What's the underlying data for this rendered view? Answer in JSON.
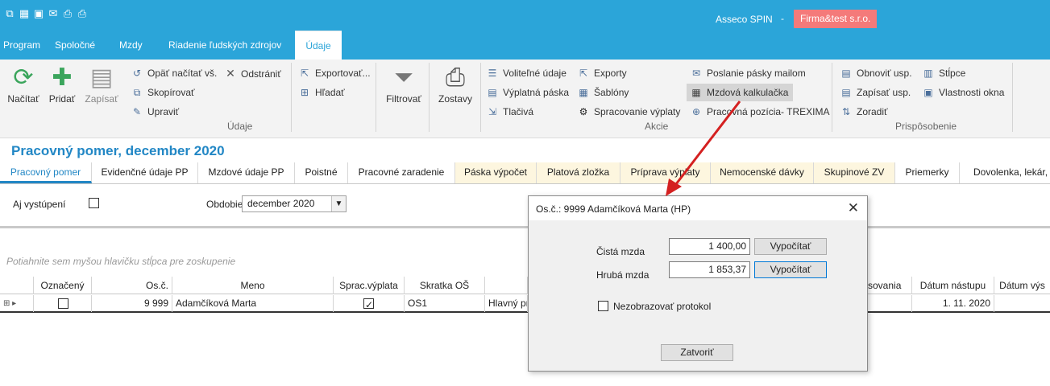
{
  "titlebar": {
    "app_name": "Asseco SPIN",
    "separator": "-",
    "firm": "Firma&test s.r.o."
  },
  "menu": {
    "items": [
      "Program",
      "Spoločné",
      "Mzdy",
      "Riadenie ľudských zdrojov",
      "Údaje"
    ],
    "active": "Údaje"
  },
  "ribbon": {
    "refresh": "Načítať",
    "add": "Pridať",
    "save": "Zapísať",
    "reload_all": "Opäť načítať vš.",
    "remove": "Odstrániť",
    "copy": "Skopírovať",
    "edit": "Upraviť",
    "group_data": "Údaje",
    "export": "Exportovať...",
    "find": "Hľadať",
    "filter": "Filtrovať",
    "reports": "Zostavy",
    "optional_data": "Voliteľné údaje",
    "payslip": "Výplatná páska",
    "forms": "Tlačivá",
    "exports": "Exporty",
    "templates": "Šablóny",
    "payroll_processing": "Spracovanie výplaty",
    "send_payslip": "Poslanie pásky mailom",
    "wage_calculator": "Mzdová kalkulačka",
    "job_position": "Pracovná pozícia- TREXIMA",
    "group_actions": "Akcie",
    "restore_settings": "Obnoviť usp.",
    "save_settings": "Zapísať usp.",
    "sort": "Zoradiť",
    "columns": "Stĺpce",
    "window_props": "Vlastnosti okna",
    "group_customize": "Prispôsobenie"
  },
  "page": {
    "title": "Pracovný pomer, december 2020"
  },
  "tabs": [
    "Pracovný pomer",
    "Evidenčné údaje PP",
    "Mzdové údaje PP",
    "Poistné",
    "Pracovné zaradenie",
    "Páska výpočet",
    "Platová zložka",
    "Príprava výplaty",
    "Nemocenské dávky",
    "Skupinové ZV",
    "Priemerky",
    "Dovolenka, lekár, z"
  ],
  "filters": {
    "include_departed_label": "Aj vystúpení",
    "period_label": "Obdobie",
    "period_value": "december 2020"
  },
  "grid": {
    "group_hint": "Potiahnite sem myšou hlavičku stĺpca pre zoskupenie",
    "columns": [
      "Označený",
      "Os.č.",
      "Meno",
      "Sprac.výplata",
      "Skratka OŠ",
      "sovania",
      "Dátum nástupu",
      "Dátum výs"
    ],
    "row": {
      "os_c": "9 999",
      "meno": "Adamčíková Marta",
      "skratka": "OS1",
      "desc": "Hlavný pr",
      "date_start": "1. 11. 2020"
    }
  },
  "dialog": {
    "title": "Os.č.: 9999 Adamčíková Marta (HP)",
    "net_label": "Čistá mzda",
    "net_value": "1 400,00",
    "gross_label": "Hrubá mzda",
    "gross_value": "1 853,37",
    "calc_button": "Vypočítať",
    "hide_protocol": "Nezobrazovať protokol",
    "close_button": "Zatvoriť"
  },
  "colors": {
    "accent": "#2ba5d9",
    "title_blue": "#2287c5",
    "firm_badge": "#f47a7a",
    "annotation": "#d42020"
  }
}
